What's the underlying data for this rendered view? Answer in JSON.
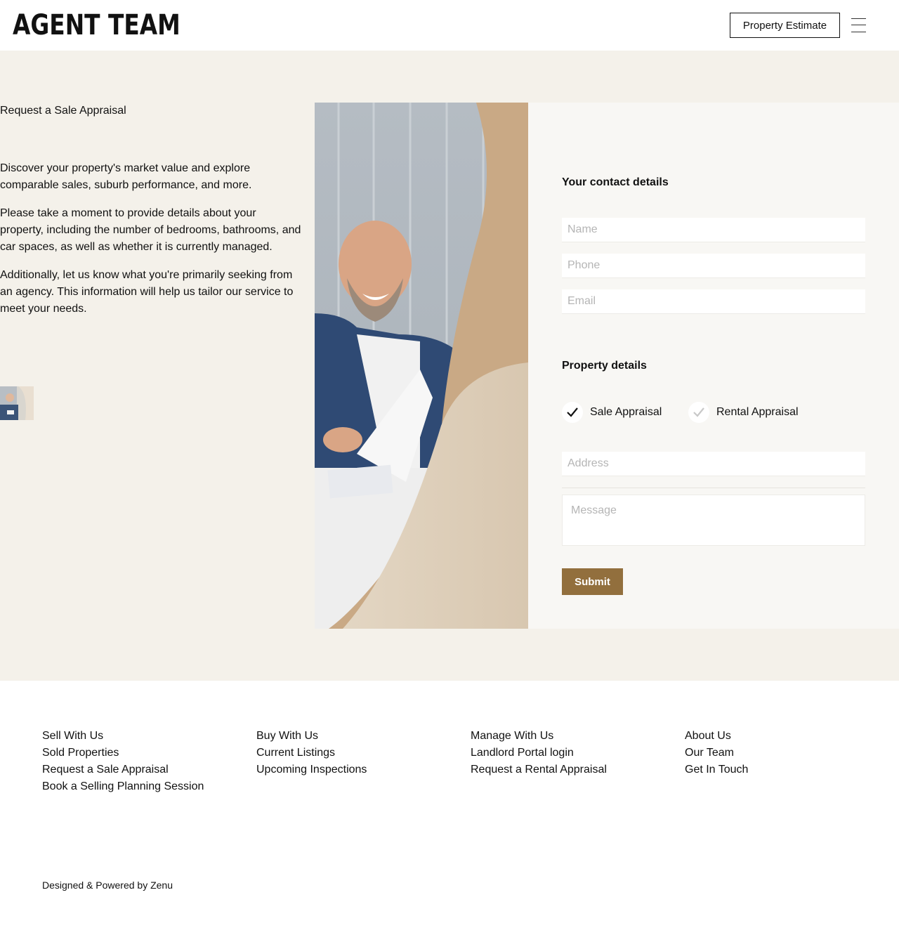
{
  "header": {
    "logo": "AGENT TEAM",
    "estimate_button": "Property Estimate",
    "menu_icon": "hamburger-menu-icon"
  },
  "intro": {
    "title": "Request a Sale Appraisal",
    "paragraphs": [
      "Discover your property's market value and explore comparable sales, suburb performance, and more.",
      "Please take a moment to provide details about your property, including the number of bedrooms, bathrooms, and car spaces, as well as whether it is currently managed.",
      "Additionally, let us know what you're primarily seeking from an agency. This information will help us tailor our service to meet your needs."
    ]
  },
  "form": {
    "contact_heading": "Your contact details",
    "name_placeholder": "Name",
    "phone_placeholder": "Phone",
    "email_placeholder": "Email",
    "property_heading": "Property details",
    "options": [
      {
        "label": "Sale Appraisal",
        "selected": true
      },
      {
        "label": "Rental Appraisal",
        "selected": false
      }
    ],
    "address_placeholder": "Address",
    "message_placeholder": "Message",
    "submit_label": "Submit"
  },
  "footer": {
    "columns": [
      [
        "Sell With Us",
        "Sold Properties",
        "Request a Sale Appraisal",
        "Book a Selling Planning Session"
      ],
      [
        "Buy With Us",
        "Current Listings",
        "Upcoming Inspections"
      ],
      [
        "Manage With Us",
        "Landlord Portal login",
        "Request a Rental Appraisal"
      ],
      [
        "About Us",
        "Our Team",
        "Get In Touch"
      ]
    ],
    "credit": "Designed & Powered by Zenu"
  },
  "colors": {
    "band_background": "#f4f1ea",
    "form_panel": "#f8f7f4",
    "submit_button": "#926f3d"
  }
}
